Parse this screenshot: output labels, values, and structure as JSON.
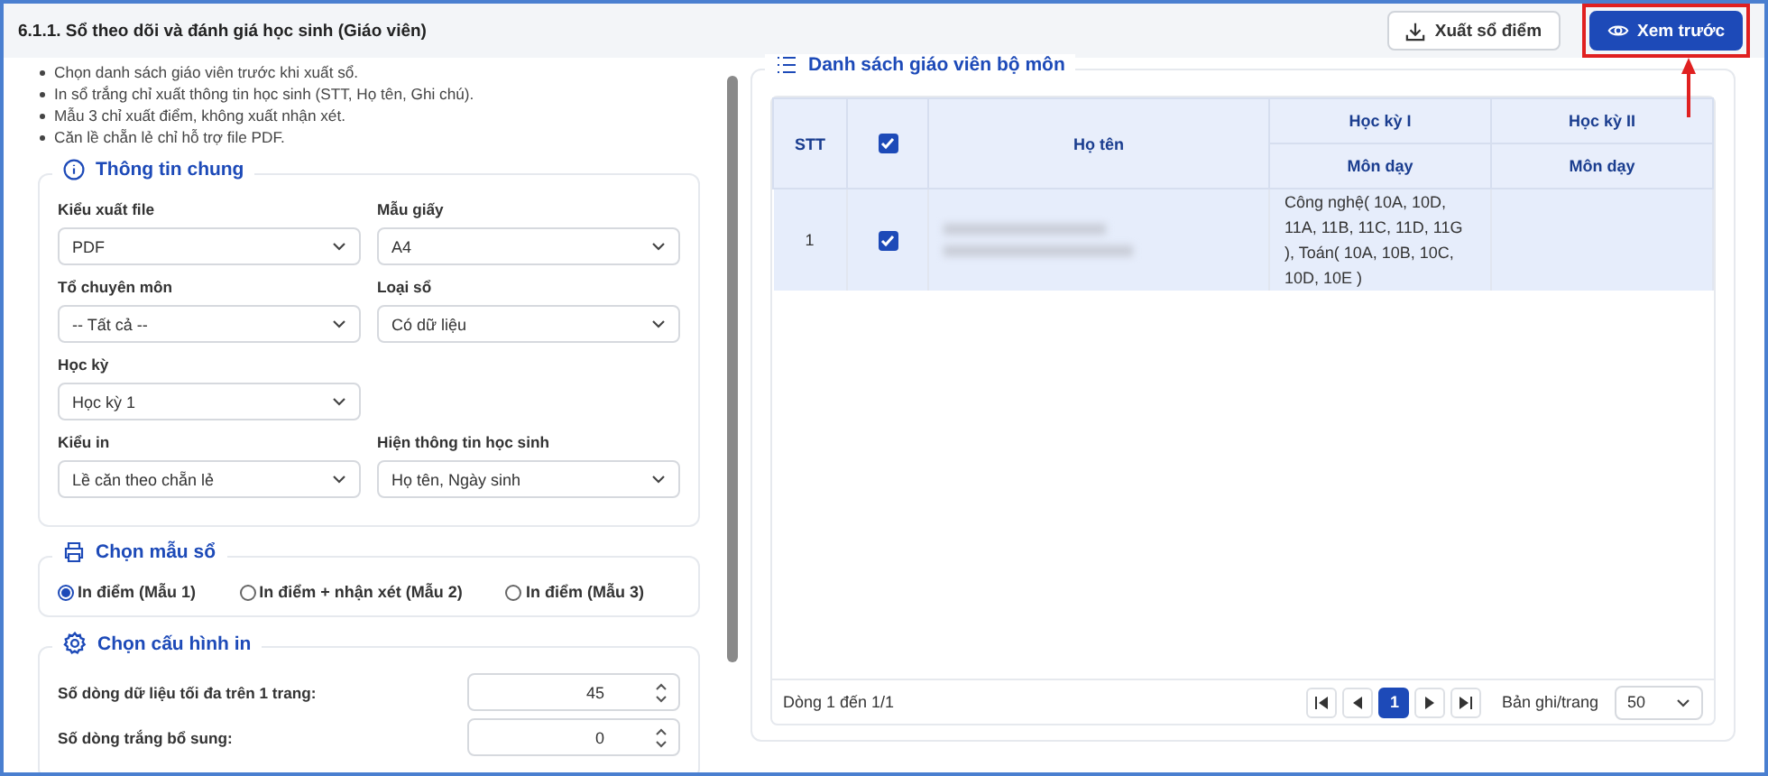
{
  "header": {
    "title": "6.1.1. Sổ theo dõi và đánh giá học sinh (Giáo viên)",
    "buttons": [
      {
        "label": "Xuất sổ điểm",
        "kind": "secondary",
        "highlighted": false
      },
      {
        "label": "Xem trước",
        "kind": "primary",
        "highlighted": true
      }
    ]
  },
  "notes": [
    "Chọn danh sách giáo viên trước khi xuất sổ.",
    "In sổ trắng chỉ xuất thông tin học sinh (STT, Họ tên, Ghi chú).",
    "Mẫu 3 chỉ xuất điểm, không xuất nhận xét.",
    "Căn lề chẵn lẻ chỉ hỗ trợ file PDF."
  ],
  "general": {
    "title": "Thông tin chung",
    "rows": [
      [
        {
          "label": "Kiểu xuất file",
          "value": "PDF"
        },
        {
          "label": "Mẫu giấy",
          "value": "A4"
        }
      ],
      [
        {
          "label": "Tổ chuyên môn",
          "value": "-- Tất cả --"
        },
        {
          "label": "Loại sổ",
          "value": "Có dữ liệu"
        }
      ],
      [
        {
          "label": "Học kỳ",
          "value": "Học kỳ 1"
        }
      ],
      [
        {
          "label": "Kiểu in",
          "value": "Lề căn theo chẵn lẻ"
        },
        {
          "label": "Hiện thông tin học sinh",
          "value": "Họ tên, Ngày sinh"
        }
      ]
    ]
  },
  "template": {
    "title": "Chọn mẫu sổ",
    "options": [
      {
        "label": "In điểm (Mẫu 1)",
        "selected": true
      },
      {
        "label": "In điểm + nhận xét (Mẫu 2)",
        "selected": false
      },
      {
        "label": "In điểm (Mẫu 3)",
        "selected": false
      }
    ]
  },
  "config": {
    "title": "Chọn cấu hình in",
    "fields": [
      {
        "label": "Số dòng dữ liệu tối đa trên 1 trang:",
        "value": "45"
      },
      {
        "label": "Số dòng trắng bổ sung:",
        "value": "0"
      }
    ]
  },
  "teachers": {
    "title": "Danh sách giáo viên bộ môn",
    "columns": {
      "stt": "STT",
      "name": "Họ tên",
      "groups": [
        {
          "label": "Học kỳ I",
          "sub": "Môn dạy"
        },
        {
          "label": "Học kỳ II",
          "sub": "Môn dạy"
        }
      ]
    },
    "all_checked": true,
    "rows": [
      {
        "stt": "1",
        "checked": true,
        "selected": true,
        "semester_1": "Công nghệ( 10A, 10D, 11A, 11B, 11C, 11D, 11G ), Toán( 10A, 10B, 10C, 10D, 10E )"
      }
    ]
  },
  "pagination": {
    "summary": "Dòng 1 đến 1/1",
    "pages": [
      {
        "label": "1",
        "selected": true
      }
    ],
    "per_page_label": "Bản ghi/trang",
    "per_page": "50"
  }
}
